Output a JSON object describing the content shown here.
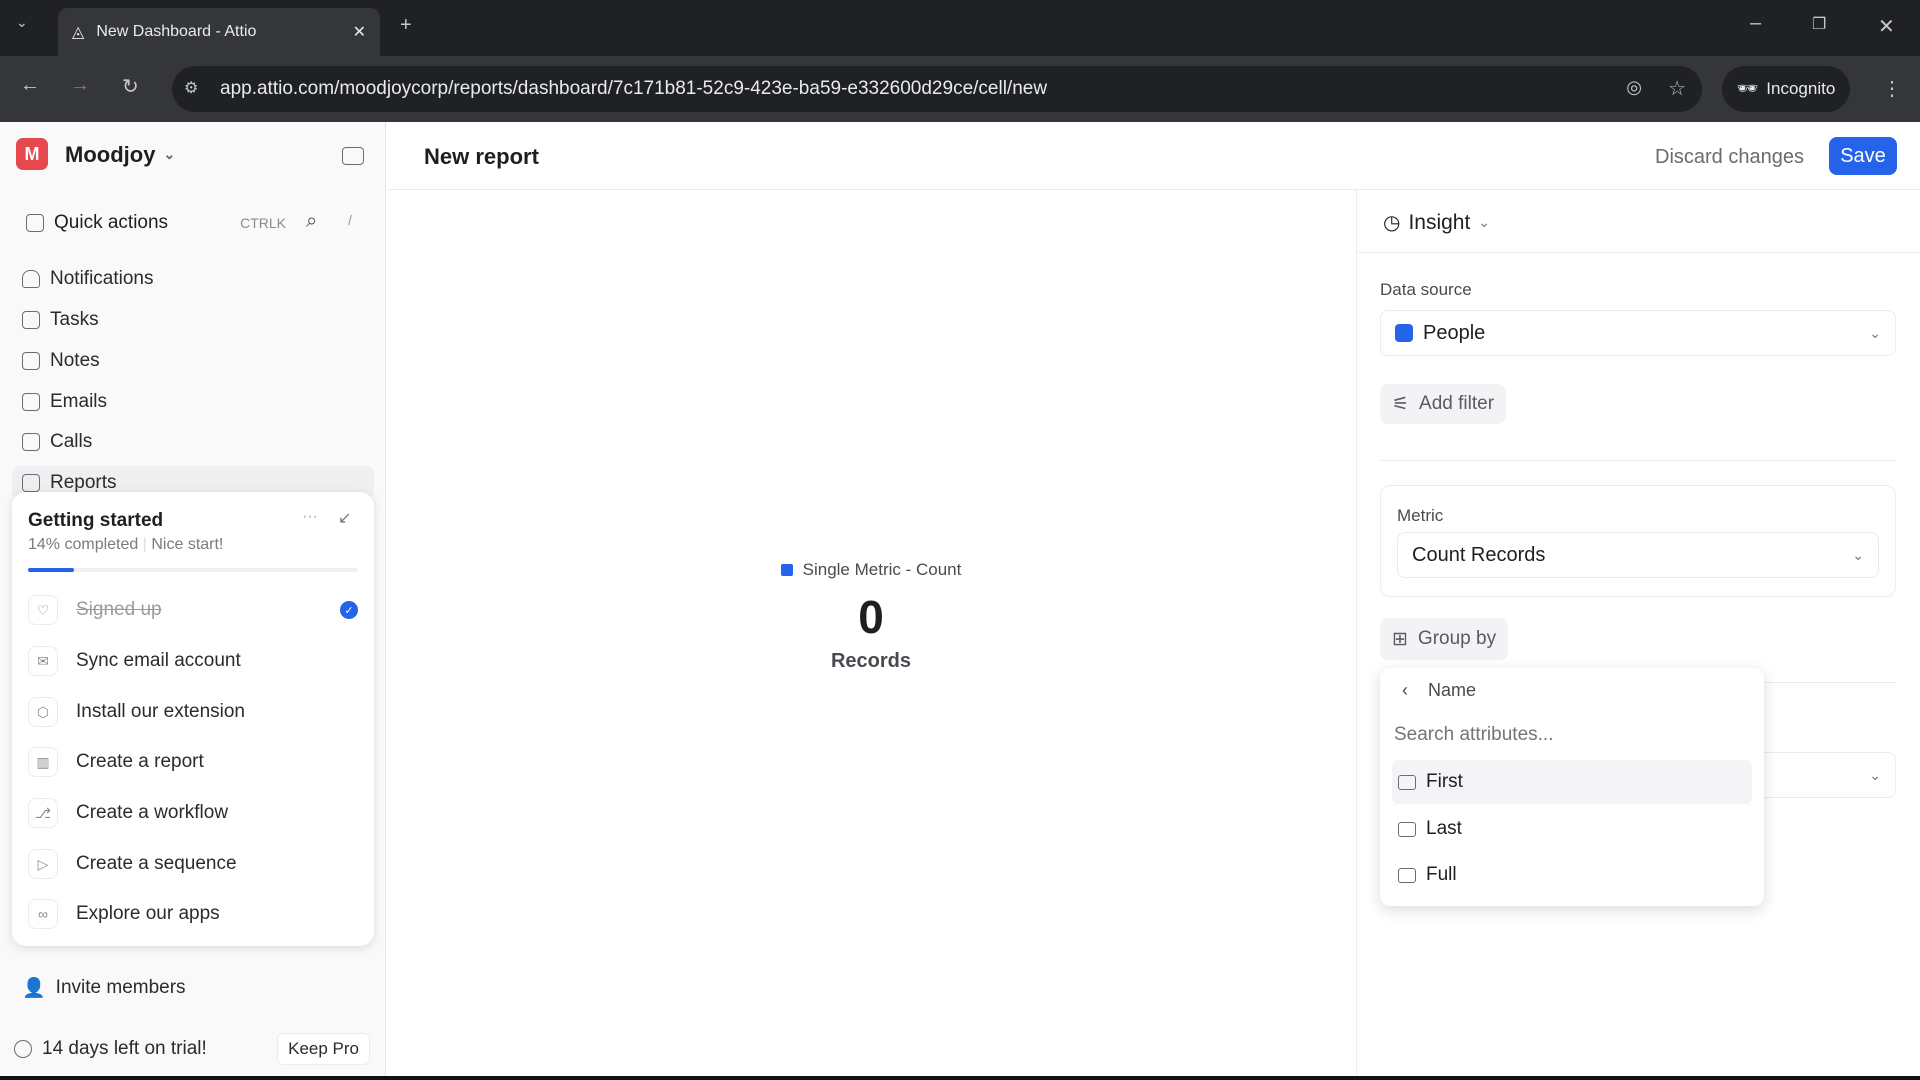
{
  "browser": {
    "tab_title": "New Dashboard - Attio",
    "url": "app.attio.com/moodjoycorp/reports/dashboard/7c171b81-52c9-423e-ba59-e332600d29ce/cell/new",
    "incognito": "Incognito"
  },
  "sidebar": {
    "workspace": "Moodjoy",
    "workspace_initial": "M",
    "quick_actions": "Quick actions",
    "shortcut": "CTRLK",
    "slash": "/",
    "items": [
      {
        "label": "Notifications"
      },
      {
        "label": "Tasks"
      },
      {
        "label": "Notes"
      },
      {
        "label": "Emails"
      },
      {
        "label": "Calls"
      },
      {
        "label": "Reports"
      }
    ],
    "getting_started": {
      "title": "Getting started",
      "progress_text": "14% completed",
      "encouragement": "Nice start!",
      "progress": 0.14,
      "tasks": [
        {
          "label": "Signed up",
          "done": true
        },
        {
          "label": "Sync email account"
        },
        {
          "label": "Install our extension"
        },
        {
          "label": "Create a report"
        },
        {
          "label": "Create a workflow"
        },
        {
          "label": "Create a sequence"
        },
        {
          "label": "Explore our apps"
        }
      ]
    },
    "invite": "Invite members",
    "trial": "14 days left on trial!",
    "keep_pro": "Keep Pro"
  },
  "header": {
    "title": "New report",
    "discard": "Discard changes",
    "save": "Save"
  },
  "preview": {
    "legend": "Single Metric - Count",
    "value": "0",
    "unit": "Records"
  },
  "panel": {
    "type": "Insight",
    "data_source_label": "Data source",
    "data_source": "People",
    "add_filter": "Add filter",
    "metric_label": "Metric",
    "metric": "Count Records",
    "group_by": "Group by",
    "menu": {
      "back_label": "Name",
      "search_placeholder": "Search attributes...",
      "items": [
        "First",
        "Last",
        "Full"
      ]
    }
  },
  "colors": {
    "accent": "#2663eb",
    "brand": "#e5484d"
  }
}
